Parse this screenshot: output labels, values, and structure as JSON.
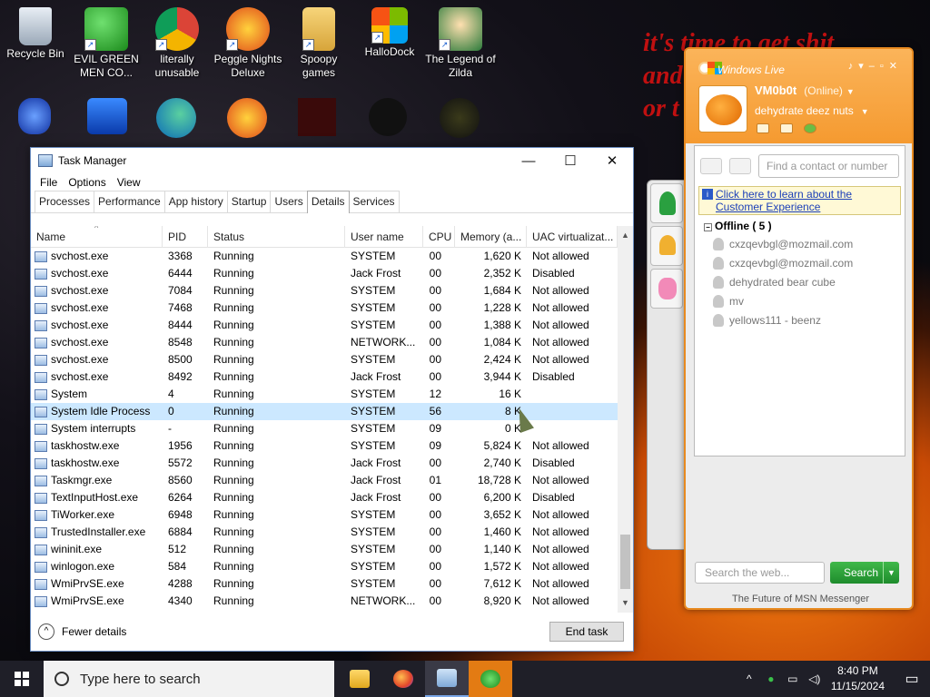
{
  "wallpaper_text": {
    "line1": "it's time to get shit",
    "line2": "and",
    "line3": "or t"
  },
  "desktop_icons": [
    {
      "label": "Recycle Bin",
      "icon": "recycle-bin-icon"
    },
    {
      "label": "EVIL GREEN MEN CO...",
      "icon": "msn-people-icon"
    },
    {
      "label": "literally unusable",
      "icon": "chrome-icon"
    },
    {
      "label": "Peggle Nights Deluxe",
      "icon": "peggle-icon"
    },
    {
      "label": "Spoopy games",
      "icon": "folder-icon"
    },
    {
      "label": "HalloDock",
      "icon": "windows-logo-icon"
    },
    {
      "label": "The Legend of Zilda",
      "icon": "zelda-icon"
    }
  ],
  "task_manager": {
    "title": "Task Manager",
    "menu": [
      "File",
      "Options",
      "View"
    ],
    "tabs": [
      "Processes",
      "Performance",
      "App history",
      "Startup",
      "Users",
      "Details",
      "Services"
    ],
    "active_tab": "Details",
    "columns": [
      "Name",
      "PID",
      "Status",
      "User name",
      "CPU",
      "Memory (a...",
      "UAC virtualizat..."
    ],
    "rows": [
      {
        "name": "svchost.exe",
        "pid": "3368",
        "status": "Running",
        "user": "SYSTEM",
        "cpu": "00",
        "mem": "1,620 K",
        "uac": "Not allowed"
      },
      {
        "name": "svchost.exe",
        "pid": "6444",
        "status": "Running",
        "user": "Jack Frost",
        "cpu": "00",
        "mem": "2,352 K",
        "uac": "Disabled"
      },
      {
        "name": "svchost.exe",
        "pid": "7084",
        "status": "Running",
        "user": "SYSTEM",
        "cpu": "00",
        "mem": "1,684 K",
        "uac": "Not allowed"
      },
      {
        "name": "svchost.exe",
        "pid": "7468",
        "status": "Running",
        "user": "SYSTEM",
        "cpu": "00",
        "mem": "1,228 K",
        "uac": "Not allowed"
      },
      {
        "name": "svchost.exe",
        "pid": "8444",
        "status": "Running",
        "user": "SYSTEM",
        "cpu": "00",
        "mem": "1,388 K",
        "uac": "Not allowed"
      },
      {
        "name": "svchost.exe",
        "pid": "8548",
        "status": "Running",
        "user": "NETWORK...",
        "cpu": "00",
        "mem": "1,084 K",
        "uac": "Not allowed"
      },
      {
        "name": "svchost.exe",
        "pid": "8500",
        "status": "Running",
        "user": "SYSTEM",
        "cpu": "00",
        "mem": "2,424 K",
        "uac": "Not allowed"
      },
      {
        "name": "svchost.exe",
        "pid": "8492",
        "status": "Running",
        "user": "Jack Frost",
        "cpu": "00",
        "mem": "3,944 K",
        "uac": "Disabled"
      },
      {
        "name": "System",
        "pid": "4",
        "status": "Running",
        "user": "SYSTEM",
        "cpu": "12",
        "mem": "16 K",
        "uac": ""
      },
      {
        "name": "System Idle Process",
        "pid": "0",
        "status": "Running",
        "user": "SYSTEM",
        "cpu": "56",
        "mem": "8 K",
        "uac": ""
      },
      {
        "name": "System interrupts",
        "pid": "-",
        "status": "Running",
        "user": "SYSTEM",
        "cpu": "09",
        "mem": "0 K",
        "uac": ""
      },
      {
        "name": "taskhostw.exe",
        "pid": "1956",
        "status": "Running",
        "user": "SYSTEM",
        "cpu": "09",
        "mem": "5,824 K",
        "uac": "Not allowed"
      },
      {
        "name": "taskhostw.exe",
        "pid": "5572",
        "status": "Running",
        "user": "Jack Frost",
        "cpu": "00",
        "mem": "2,740 K",
        "uac": "Disabled"
      },
      {
        "name": "Taskmgr.exe",
        "pid": "8560",
        "status": "Running",
        "user": "Jack Frost",
        "cpu": "01",
        "mem": "18,728 K",
        "uac": "Not allowed"
      },
      {
        "name": "TextInputHost.exe",
        "pid": "6264",
        "status": "Running",
        "user": "Jack Frost",
        "cpu": "00",
        "mem": "6,200 K",
        "uac": "Disabled"
      },
      {
        "name": "TiWorker.exe",
        "pid": "6948",
        "status": "Running",
        "user": "SYSTEM",
        "cpu": "00",
        "mem": "3,652 K",
        "uac": "Not allowed"
      },
      {
        "name": "TrustedInstaller.exe",
        "pid": "6884",
        "status": "Running",
        "user": "SYSTEM",
        "cpu": "00",
        "mem": "1,460 K",
        "uac": "Not allowed"
      },
      {
        "name": "wininit.exe",
        "pid": "512",
        "status": "Running",
        "user": "SYSTEM",
        "cpu": "00",
        "mem": "1,140 K",
        "uac": "Not allowed"
      },
      {
        "name": "winlogon.exe",
        "pid": "584",
        "status": "Running",
        "user": "SYSTEM",
        "cpu": "00",
        "mem": "1,572 K",
        "uac": "Not allowed"
      },
      {
        "name": "WmiPrvSE.exe",
        "pid": "4288",
        "status": "Running",
        "user": "SYSTEM",
        "cpu": "00",
        "mem": "7,612 K",
        "uac": "Not allowed"
      },
      {
        "name": "WmiPrvSE.exe",
        "pid": "4340",
        "status": "Running",
        "user": "NETWORK...",
        "cpu": "00",
        "mem": "8,920 K",
        "uac": "Not allowed"
      }
    ],
    "selected_row": "System Idle Process",
    "fewer_details": "Fewer details",
    "end_task": "End task"
  },
  "msn": {
    "brand": "Windows Live",
    "username": "VM0b0t",
    "status": "(Online)",
    "personal_message": "dehydrate deez nuts",
    "find_placeholder": "Find a contact or number",
    "promo": "Click here to learn about the Customer Experience",
    "group": "Offline ( 5 )",
    "contacts": [
      "cxzqevbgl@mozmail.com",
      "cxzqevbgl@mozmail.com",
      "dehydrated bear cube",
      "mv",
      "yellows111 - beenz"
    ],
    "search_placeholder": "Search the web...",
    "search_button": "Search",
    "footer": "The Future of MSN Messenger",
    "brand_color": "#f59a30"
  },
  "taskbar": {
    "search_placeholder": "Type here to search",
    "time": "8:40 PM",
    "date": "11/15/2024",
    "apps": [
      "file-explorer-icon",
      "firefox-icon",
      "task-manager-icon",
      "msn-messenger-icon"
    ]
  }
}
